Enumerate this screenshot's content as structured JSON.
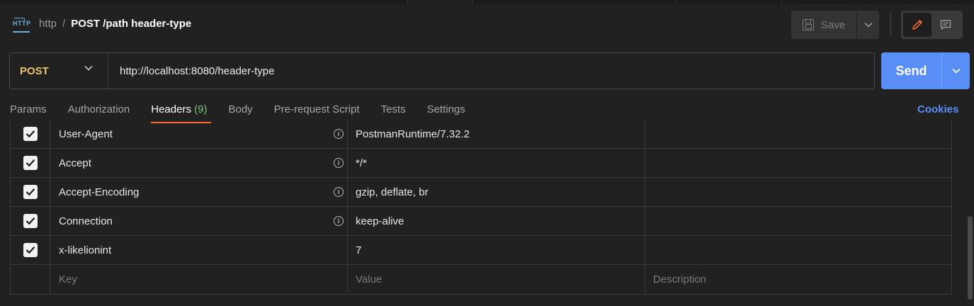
{
  "header": {
    "icon": "http-request-icon",
    "breadcrumb_parent": "http",
    "breadcrumb_separator": "/",
    "title": "POST /path header-type",
    "save_label": "Save"
  },
  "request": {
    "method": "POST",
    "url": "http://localhost:8080/header-type",
    "send_label": "Send"
  },
  "tabs": [
    {
      "label": "Params",
      "count": ""
    },
    {
      "label": "Authorization",
      "count": ""
    },
    {
      "label": "Headers",
      "count": "(9)"
    },
    {
      "label": "Body",
      "count": ""
    },
    {
      "label": "Pre-request Script",
      "count": ""
    },
    {
      "label": "Tests",
      "count": ""
    },
    {
      "label": "Settings",
      "count": ""
    }
  ],
  "active_tab": "Headers",
  "cookies_label": "Cookies",
  "headers": {
    "rows": [
      {
        "checked": true,
        "key": "User-Agent",
        "value": "PostmanRuntime/7.32.2",
        "description": "",
        "info": true
      },
      {
        "checked": true,
        "key": "Accept",
        "value": "*/*",
        "description": "",
        "info": true
      },
      {
        "checked": true,
        "key": "Accept-Encoding",
        "value": "gzip, deflate, br",
        "description": "",
        "info": true
      },
      {
        "checked": true,
        "key": "Connection",
        "value": "keep-alive",
        "description": "",
        "info": true
      },
      {
        "checked": true,
        "key": "x-likelionint",
        "value": "7",
        "description": "",
        "info": false
      }
    ],
    "placeholders": {
      "key": "Key",
      "value": "Value",
      "description": "Description"
    }
  },
  "colors": {
    "method": "#e9c46a",
    "send": "#5a8ef7",
    "active_tab_underline": "#ff6c37",
    "tab_count": "#7bc47f",
    "link": "#5a8ef7"
  }
}
